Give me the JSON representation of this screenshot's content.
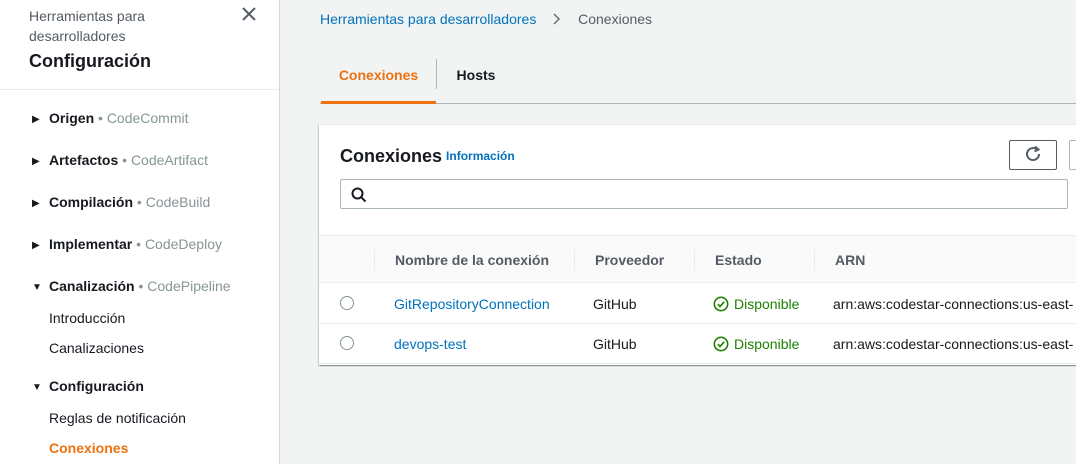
{
  "sidebar": {
    "parent": "Herramientas para desarrolladores",
    "title": "Configuración",
    "sections": [
      {
        "label": "Origen",
        "service": "CodeCommit",
        "expanded": false
      },
      {
        "label": "Artefactos",
        "service": "CodeArtifact",
        "expanded": false
      },
      {
        "label": "Compilación",
        "service": "CodeBuild",
        "expanded": false
      },
      {
        "label": "Implementar",
        "service": "CodeDeploy",
        "expanded": false
      },
      {
        "label": "Canalización",
        "service": "CodePipeline",
        "expanded": true
      },
      {
        "label": "Configuración",
        "service": "",
        "expanded": true
      }
    ],
    "separator": "•",
    "pipeline_links": [
      "Introducción",
      "Canalizaciones"
    ],
    "settings_links": [
      "Reglas de notificación",
      "Conexiones"
    ]
  },
  "breadcrumb": {
    "parent": "Herramientas para desarrolladores",
    "current": "Conexiones"
  },
  "tabs": [
    {
      "label": "Conexiones",
      "active": true
    },
    {
      "label": "Hosts",
      "active": false
    }
  ],
  "panel": {
    "title": "Conexiones",
    "info": "Información",
    "search_placeholder": "",
    "columns": [
      "Nombre de la conexión",
      "Proveedor",
      "Estado",
      "ARN"
    ],
    "rows": [
      {
        "name": "GitRepositoryConnection",
        "provider": "GitHub",
        "status": "Disponible",
        "arn": "arn:aws:codestar-connections:us-east-"
      },
      {
        "name": "devops-test",
        "provider": "GitHub",
        "status": "Disponible",
        "arn": "arn:aws:codestar-connections:us-east-"
      }
    ]
  },
  "colors": {
    "accent": "#ec7211",
    "link": "#0073bb",
    "success": "#1d8102"
  },
  "icons": [
    "close-icon",
    "caret-right-icon",
    "caret-down-icon",
    "chevron-right-icon",
    "refresh-icon",
    "search-icon",
    "check-circle-icon"
  ]
}
